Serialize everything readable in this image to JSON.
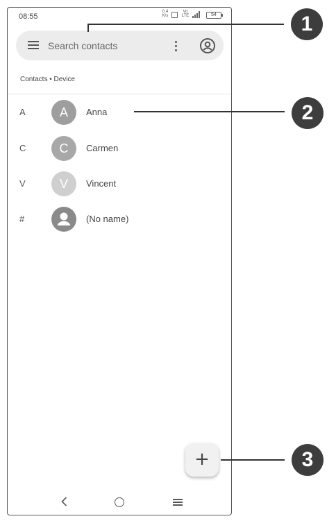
{
  "status_bar": {
    "time": "08:55",
    "net_speed": "0.4 K/s",
    "volte": "Vo LTE",
    "battery": "54"
  },
  "search": {
    "placeholder": "Search contacts"
  },
  "section_label": "Contacts • Device",
  "contacts": [
    {
      "letter": "A",
      "initial": "A",
      "name": "Anna",
      "color": "#9e9e9e"
    },
    {
      "letter": "C",
      "initial": "C",
      "name": "Carmen",
      "color": "#a8a8a8"
    },
    {
      "letter": "V",
      "initial": "V",
      "name": "Vincent",
      "color": "#cfcfcf"
    },
    {
      "letter": "#",
      "initial": "",
      "name": "(No name)",
      "color": "#8a8a8a"
    }
  ],
  "fab": {
    "label": "+"
  },
  "callouts": [
    "1",
    "2",
    "3"
  ],
  "icons": [
    "menu-icon",
    "more-vert-icon",
    "account-circle-icon",
    "person-icon",
    "add-icon",
    "back-icon",
    "home-icon",
    "recents-icon"
  ]
}
